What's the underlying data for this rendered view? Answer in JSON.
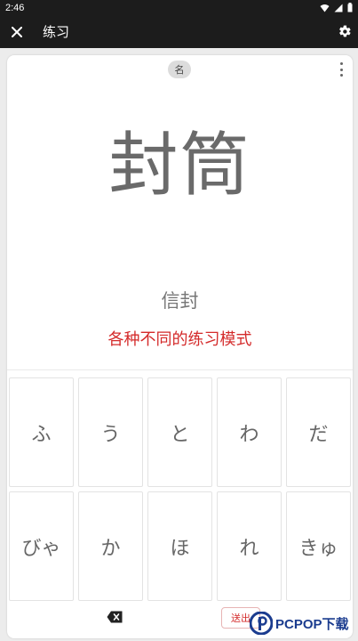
{
  "status_bar": {
    "time": "2:46"
  },
  "app_bar": {
    "title": "练习"
  },
  "card": {
    "tag": "名",
    "word": "封筒",
    "reading": "信封",
    "promo": "各种不同的练习模式"
  },
  "keys": [
    "ふ",
    "う",
    "と",
    "わ",
    "だ",
    "びゃ",
    "か",
    "ほ",
    "れ",
    "きゅ"
  ],
  "send_label": "送出",
  "watermark": {
    "text": "PCPOP下载"
  },
  "colors": {
    "accent": "#d42b2b",
    "bar": "#1c1c1c",
    "watermark": "#1b3c8f"
  }
}
